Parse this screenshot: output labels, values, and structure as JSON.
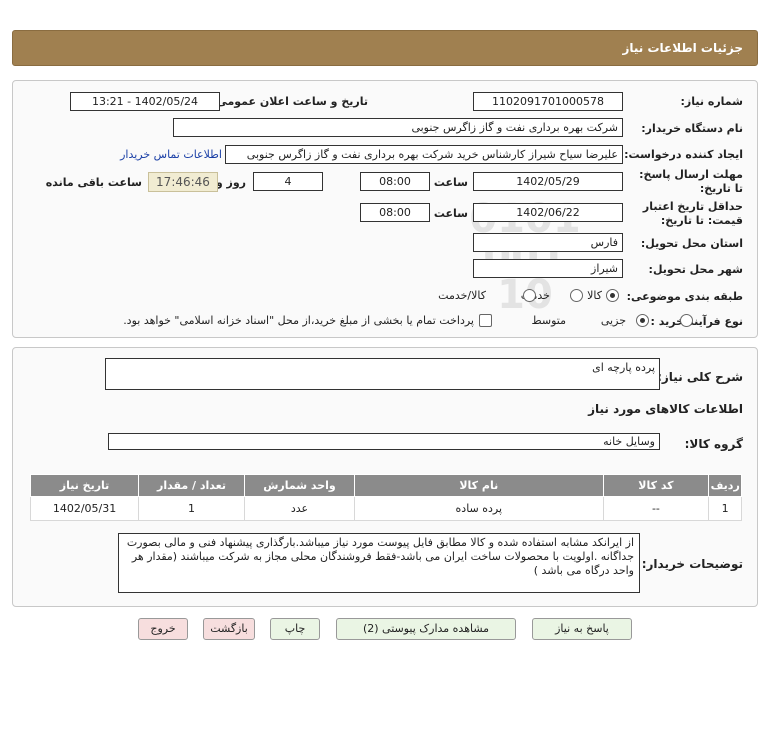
{
  "header": {
    "title": "جزئیات اطلاعات نیاز"
  },
  "fields": {
    "need_number_label": "شماره نیاز:",
    "need_number": "1102091701000578",
    "announce_label": "تاریخ و ساعت اعلان عمومی:",
    "announce_value": "1402/05/24 - 13:21",
    "buyer_label": "نام دستگاه خریدار:",
    "buyer_value": "شرکت بهره برداری نفت و گاز زاگرس جنوبی",
    "creator_label": "ایجاد کننده درخواست:",
    "creator_value": "علیرضا سیاح شیراز کارشناس خرید شرکت بهره برداری نفت و گاز زاگرس جنوبی",
    "contact_link": "اطلاعات تماس خریدار",
    "reply_deadline_label": "مهلت ارسال پاسخ: تا تاریخ:",
    "reply_date": "1402/05/29",
    "time_label": "ساعت",
    "reply_time": "08:00",
    "days_value": "4",
    "days_label": "روز و",
    "remaining_time": "17:46:46",
    "remaining_label": "ساعت باقی مانده",
    "validity_label": "حداقل تاریخ اعتبار قیمت: تا تاریخ:",
    "validity_date": "1402/06/22",
    "validity_time": "08:00",
    "province_label": "استان محل تحویل:",
    "province_value": "فارس",
    "city_label": "شهر محل تحویل:",
    "city_value": "شیراز",
    "category_label": "طبقه بندی موضوعی:",
    "category_options": [
      "کالا",
      "خدمت",
      "کالا/خدمت"
    ],
    "process_label": "نوع فرآیند خرید :",
    "process_options": [
      "جزیی",
      "متوسط"
    ],
    "payment_note": "پرداخت تمام یا بخشی از مبلغ خرید،از محل \"اسناد خزانه اسلامی\" خواهد بود."
  },
  "description": {
    "label": "شرح کلی نیاز:",
    "value": "پرده پارچه ای"
  },
  "goods": {
    "section_title": "اطلاعات کالاهای مورد نیاز",
    "group_label": "گروه کالا:",
    "group_value": "وسایل خانه",
    "columns": [
      "ردیف",
      "کد کالا",
      "نام کالا",
      "واحد شمارش",
      "تعداد / مقدار",
      "تاریخ نیاز"
    ],
    "rows": [
      [
        "1",
        "--",
        "پرده ساده",
        "عدد",
        "1",
        "1402/05/31"
      ]
    ]
  },
  "notes": {
    "label": "توضیحات خریدار:",
    "text": "از ایرانکد مشابه استفاده شده و کالا مطابق فایل پیوست مورد نیاز میباشد.بارگذاری پیشنهاد فنی و مالی بصورت جداگانه .اولویت با محصولات ساخت ایران می باشد-فقط فروشندگان محلی مجاز به شرکت میباشند (مقدار هر واحد درگاه می باشد )"
  },
  "buttons": {
    "reply": "پاسخ به نیاز",
    "attachments": "مشاهده مدارک پیوستی (2)",
    "print": "چاپ",
    "back": "بازگشت",
    "exit": "خروج"
  },
  "watermark": {
    "brand": "ParsNamadData",
    "line1": "مرکز فراوری اطلاعات پارس نماد داده ها",
    "line2": "پایگاه اطلاع رسانی مناقصات و مزایده",
    "phone": "۰۲۱-۸۸۳۴۹۶۷۰-۵",
    "digits": "0101 001 10"
  },
  "colors": {
    "header_bg": "#a08050",
    "table_header": "#8b8b8b",
    "button_green": "#eaf5e4",
    "button_pink": "#f7dede",
    "link": "#1a3fa6"
  }
}
